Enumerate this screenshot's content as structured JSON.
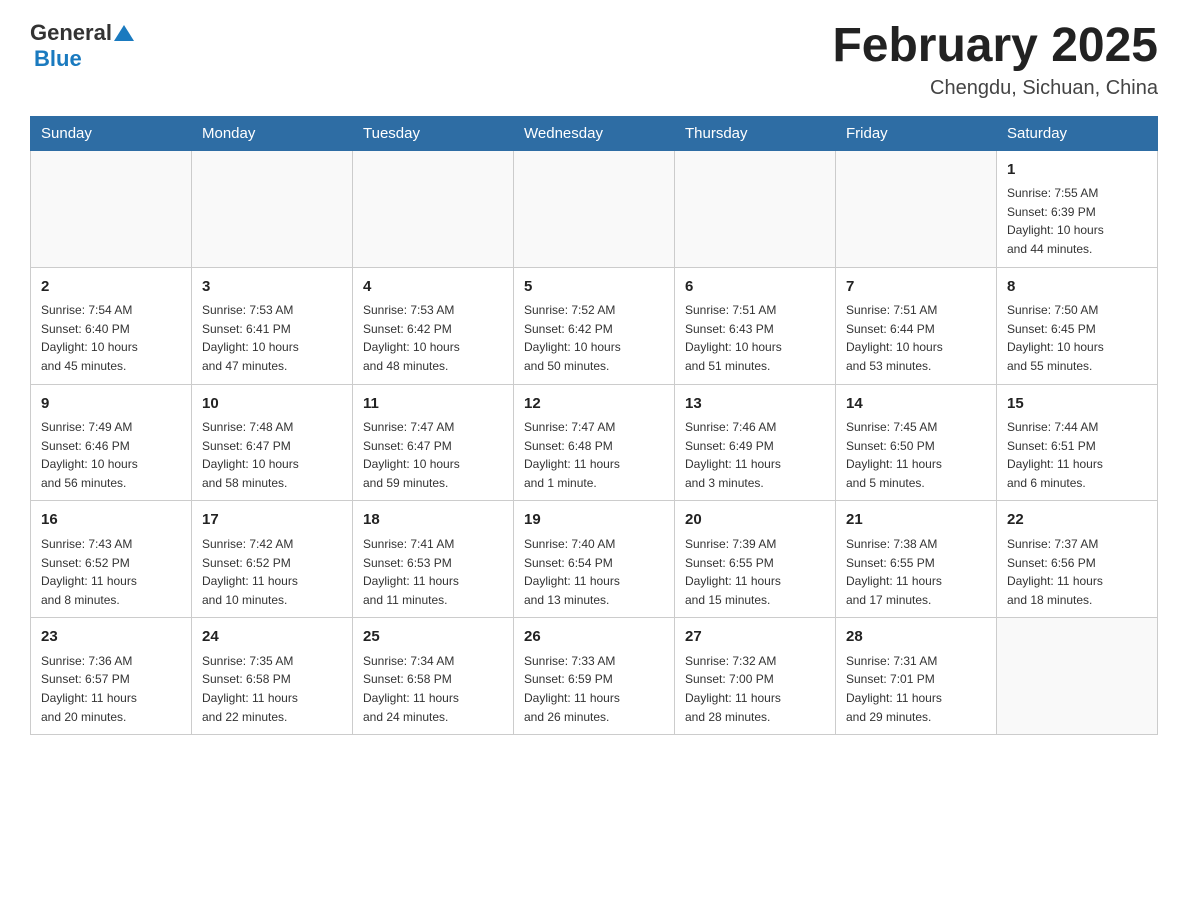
{
  "header": {
    "logo": {
      "general": "General",
      "blue": "Blue"
    },
    "title": "February 2025",
    "location": "Chengdu, Sichuan, China"
  },
  "days_of_week": [
    "Sunday",
    "Monday",
    "Tuesday",
    "Wednesday",
    "Thursday",
    "Friday",
    "Saturday"
  ],
  "weeks": [
    [
      {
        "day": "",
        "info": ""
      },
      {
        "day": "",
        "info": ""
      },
      {
        "day": "",
        "info": ""
      },
      {
        "day": "",
        "info": ""
      },
      {
        "day": "",
        "info": ""
      },
      {
        "day": "",
        "info": ""
      },
      {
        "day": "1",
        "info": "Sunrise: 7:55 AM\nSunset: 6:39 PM\nDaylight: 10 hours\nand 44 minutes."
      }
    ],
    [
      {
        "day": "2",
        "info": "Sunrise: 7:54 AM\nSunset: 6:40 PM\nDaylight: 10 hours\nand 45 minutes."
      },
      {
        "day": "3",
        "info": "Sunrise: 7:53 AM\nSunset: 6:41 PM\nDaylight: 10 hours\nand 47 minutes."
      },
      {
        "day": "4",
        "info": "Sunrise: 7:53 AM\nSunset: 6:42 PM\nDaylight: 10 hours\nand 48 minutes."
      },
      {
        "day": "5",
        "info": "Sunrise: 7:52 AM\nSunset: 6:42 PM\nDaylight: 10 hours\nand 50 minutes."
      },
      {
        "day": "6",
        "info": "Sunrise: 7:51 AM\nSunset: 6:43 PM\nDaylight: 10 hours\nand 51 minutes."
      },
      {
        "day": "7",
        "info": "Sunrise: 7:51 AM\nSunset: 6:44 PM\nDaylight: 10 hours\nand 53 minutes."
      },
      {
        "day": "8",
        "info": "Sunrise: 7:50 AM\nSunset: 6:45 PM\nDaylight: 10 hours\nand 55 minutes."
      }
    ],
    [
      {
        "day": "9",
        "info": "Sunrise: 7:49 AM\nSunset: 6:46 PM\nDaylight: 10 hours\nand 56 minutes."
      },
      {
        "day": "10",
        "info": "Sunrise: 7:48 AM\nSunset: 6:47 PM\nDaylight: 10 hours\nand 58 minutes."
      },
      {
        "day": "11",
        "info": "Sunrise: 7:47 AM\nSunset: 6:47 PM\nDaylight: 10 hours\nand 59 minutes."
      },
      {
        "day": "12",
        "info": "Sunrise: 7:47 AM\nSunset: 6:48 PM\nDaylight: 11 hours\nand 1 minute."
      },
      {
        "day": "13",
        "info": "Sunrise: 7:46 AM\nSunset: 6:49 PM\nDaylight: 11 hours\nand 3 minutes."
      },
      {
        "day": "14",
        "info": "Sunrise: 7:45 AM\nSunset: 6:50 PM\nDaylight: 11 hours\nand 5 minutes."
      },
      {
        "day": "15",
        "info": "Sunrise: 7:44 AM\nSunset: 6:51 PM\nDaylight: 11 hours\nand 6 minutes."
      }
    ],
    [
      {
        "day": "16",
        "info": "Sunrise: 7:43 AM\nSunset: 6:52 PM\nDaylight: 11 hours\nand 8 minutes."
      },
      {
        "day": "17",
        "info": "Sunrise: 7:42 AM\nSunset: 6:52 PM\nDaylight: 11 hours\nand 10 minutes."
      },
      {
        "day": "18",
        "info": "Sunrise: 7:41 AM\nSunset: 6:53 PM\nDaylight: 11 hours\nand 11 minutes."
      },
      {
        "day": "19",
        "info": "Sunrise: 7:40 AM\nSunset: 6:54 PM\nDaylight: 11 hours\nand 13 minutes."
      },
      {
        "day": "20",
        "info": "Sunrise: 7:39 AM\nSunset: 6:55 PM\nDaylight: 11 hours\nand 15 minutes."
      },
      {
        "day": "21",
        "info": "Sunrise: 7:38 AM\nSunset: 6:55 PM\nDaylight: 11 hours\nand 17 minutes."
      },
      {
        "day": "22",
        "info": "Sunrise: 7:37 AM\nSunset: 6:56 PM\nDaylight: 11 hours\nand 18 minutes."
      }
    ],
    [
      {
        "day": "23",
        "info": "Sunrise: 7:36 AM\nSunset: 6:57 PM\nDaylight: 11 hours\nand 20 minutes."
      },
      {
        "day": "24",
        "info": "Sunrise: 7:35 AM\nSunset: 6:58 PM\nDaylight: 11 hours\nand 22 minutes."
      },
      {
        "day": "25",
        "info": "Sunrise: 7:34 AM\nSunset: 6:58 PM\nDaylight: 11 hours\nand 24 minutes."
      },
      {
        "day": "26",
        "info": "Sunrise: 7:33 AM\nSunset: 6:59 PM\nDaylight: 11 hours\nand 26 minutes."
      },
      {
        "day": "27",
        "info": "Sunrise: 7:32 AM\nSunset: 7:00 PM\nDaylight: 11 hours\nand 28 minutes."
      },
      {
        "day": "28",
        "info": "Sunrise: 7:31 AM\nSunset: 7:01 PM\nDaylight: 11 hours\nand 29 minutes."
      },
      {
        "day": "",
        "info": ""
      }
    ]
  ]
}
